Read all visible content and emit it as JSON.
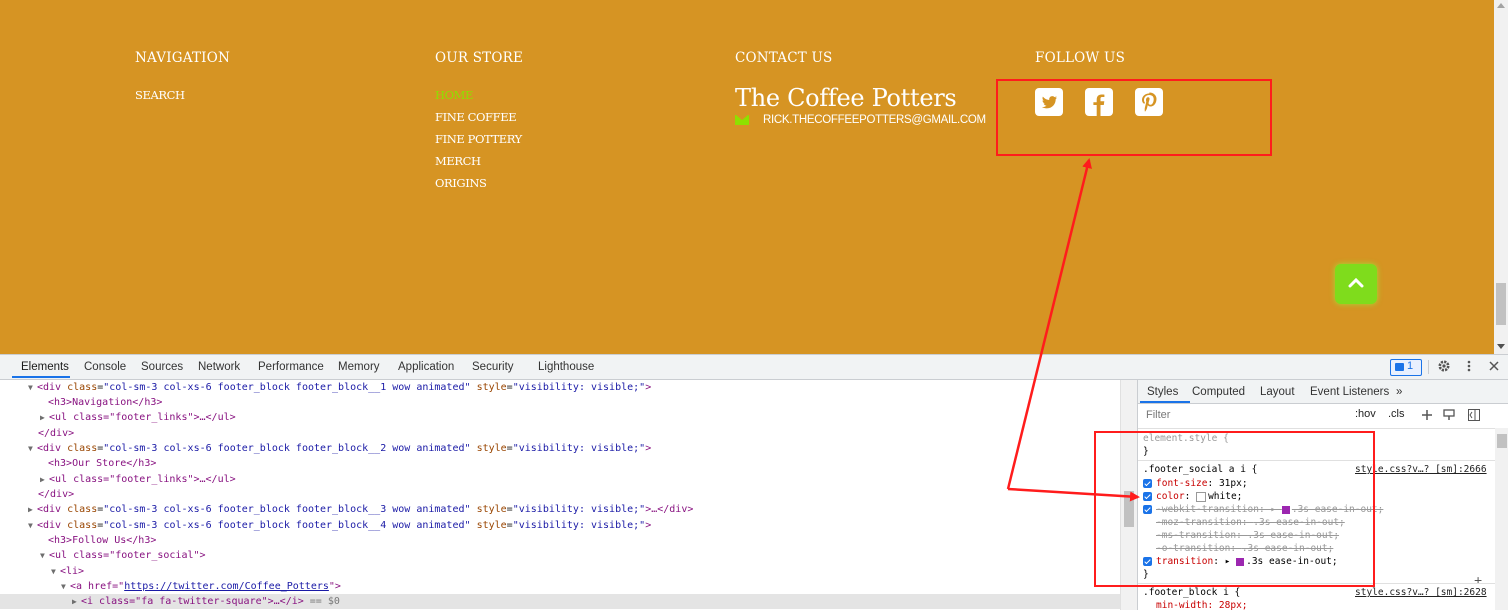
{
  "footer": {
    "background": "#d69423",
    "accent": "#8ee000",
    "navigation": {
      "title": "NAVIGATION",
      "links": [
        "SEARCH"
      ]
    },
    "store": {
      "title": "OUR STORE",
      "links": [
        "HOME",
        "FINE COFFEE",
        "FINE POTTERY",
        "MERCH",
        "ORIGINS"
      ],
      "active": "HOME"
    },
    "contact": {
      "title": "CONTACT US",
      "brand": "The Coffee Potters",
      "email": "RICK.THECOFFEEPOTTERS@GMAIL.COM",
      "email_icon": "envelope-icon"
    },
    "follow": {
      "title": "FOLLOW US",
      "icons": [
        "twitter-square-icon",
        "facebook-square-icon",
        "pinterest-square-icon"
      ]
    },
    "back_to_top_icon": "chevron-up-icon"
  },
  "devtools": {
    "tabs": [
      "Elements",
      "Console",
      "Sources",
      "Network",
      "Performance",
      "Memory",
      "Application",
      "Security",
      "Lighthouse"
    ],
    "active_tab": "Elements",
    "issues_count": "1",
    "dom_lines": [
      {
        "tri": "▼",
        "tag": "div",
        "class": "col-sm-3 col-xs-6 footer_block footer_block__1 wow animated",
        "style": "visibility: visible;"
      },
      {
        "inner": "<h3>Navigation</h3>"
      },
      {
        "tri": "▶",
        "inner": "<ul class=\"footer_links\">…</ul>"
      },
      {
        "inner": "</div>"
      },
      {
        "tri": "▼",
        "tag": "div",
        "class": "col-sm-3 col-xs-6 footer_block footer_block__2 wow animated",
        "style": "visibility: visible;"
      },
      {
        "inner": "<h3>Our Store</h3>"
      },
      {
        "tri": "▶",
        "inner": "<ul class=\"footer_links\">…</ul>"
      },
      {
        "inner": "</div>"
      },
      {
        "tri": "▶",
        "tag": "div",
        "class": "col-sm-3 col-xs-6 footer_block footer_block__3 wow animated",
        "style": "visibility: visible;",
        "tail": "…</div>"
      },
      {
        "tri": "▼",
        "tag": "div",
        "class": "col-sm-3 col-xs-6 footer_block footer_block__4 wow animated",
        "style": "visibility: visible;"
      },
      {
        "inner": "<h3>Follow Us</h3>"
      },
      {
        "tri": "▼",
        "inner": "<ul class=\"footer_social\">"
      },
      {
        "tri": "▼",
        "inner": "<li>"
      },
      {
        "tri": "▼",
        "inner": "<a href=\"",
        "link": "https://twitter.com/Coffee_Potters",
        "after": "\">"
      },
      {
        "tri": "▶",
        "inner": "<i class=\"fa fa-twitter-square\">…</i>",
        "ref": " == $0"
      }
    ],
    "styles_tabs": [
      "Styles",
      "Computed",
      "Layout",
      "Event Listeners",
      "»"
    ],
    "filter_placeholder": "Filter",
    "hov": ":hov",
    "cls": ".cls",
    "element_style": "element.style {",
    "rule1": {
      "selector": ".footer_social a i {",
      "source": "style.css?v…? [sm]:2666",
      "declarations": [
        {
          "prop": "font-size",
          "value": "31px;",
          "checked": true,
          "struck": false
        },
        {
          "prop": "color",
          "value": "white;",
          "checked": true,
          "struck": false,
          "swatch": "#ffffff"
        },
        {
          "prop": "-webkit-transition",
          "value": ".3s ease-in-out;",
          "checked": true,
          "struck": true
        },
        {
          "prop": "-moz-transition",
          "value": ".3s ease-in-out;",
          "checked": false,
          "struck": true
        },
        {
          "prop": "-ms-transition",
          "value": ".3s ease-in-out;",
          "checked": false,
          "struck": true
        },
        {
          "prop": "-o-transition",
          "value": ".3s ease-in-out;",
          "checked": false,
          "struck": true
        },
        {
          "prop": "transition",
          "value": ".3s ease-in-out;",
          "checked": true,
          "struck": false
        }
      ]
    },
    "rule2": {
      "selector": ".footer_block i {",
      "source": "style.css?v…? [sm]:2628",
      "partial": "min-width: 28px;"
    }
  }
}
